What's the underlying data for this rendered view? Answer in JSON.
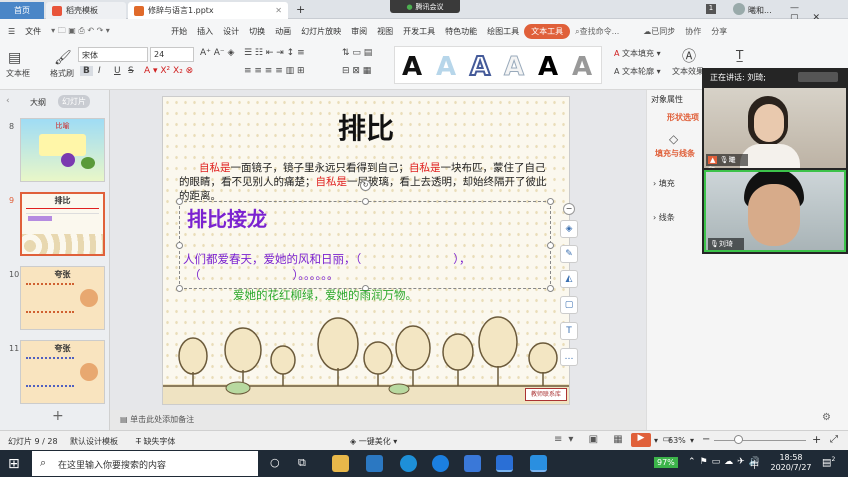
{
  "tabs": {
    "home": "首页",
    "template": "稻壳模板",
    "file": "修辞与语言1.pptx",
    "meeting": "腾讯会议",
    "user": "曦和..."
  },
  "menu": {
    "file": "文件",
    "items": [
      "开始",
      "插入",
      "设计",
      "切换",
      "动画",
      "幻灯片放映",
      "审阅",
      "视图",
      "开发工具",
      "特色功能",
      "绘图工具",
      "文本工具"
    ],
    "search": "查找命令...",
    "sync": "已同步",
    "collab": "协作",
    "share": "分享"
  },
  "toolbar": {
    "textbox": "文本框",
    "painter": "格式刷",
    "font": "宋体",
    "size": "24",
    "fill": "文本填充",
    "outline": "文本轮廓",
    "effect": "文本效果",
    "bold": "B",
    "italic": "I",
    "underline": "U",
    "strike": "S"
  },
  "panel": {
    "outline": "大纲",
    "slides": "幻灯片"
  },
  "thumbs": [
    {
      "num": "8",
      "title": "比喻"
    },
    {
      "num": "9",
      "title": "排比"
    },
    {
      "num": "10",
      "title": "夸张"
    },
    {
      "num": "11",
      "title": "夸张"
    }
  ],
  "slide": {
    "title": "排比",
    "para_prefix1": "自私是",
    "para_a": "一面镜子，镜子里永远只看得到自己；",
    "para_prefix2": "自私是",
    "para_b": "一块布匹，蒙住了自己的眼睛，看不见别人的痛楚；",
    "para_prefix3": "自私是",
    "para_c": "一层玻璃，看上去透明，却始终隔开了彼此的距离。",
    "heading": "排比接龙",
    "line1": "人们都爱春天，爱她的风和日丽，（　　　　　　　　），",
    "line2": "（　　　　　　　　）。。。。。。",
    "line3": "爱她的花红柳绿，爱她的雨润万物。",
    "badge": "教师联系库"
  },
  "rightpanel": {
    "props": "对象属性",
    "shape": "形状选项",
    "fillline": "填充与线条",
    "fill": "填充",
    "line": "线条"
  },
  "video": {
    "speaking": "正在讲话: 刘琦;",
    "p1": "曦和...",
    "p2": "刘琦"
  },
  "status": {
    "slideinfo": "幻灯片 9 / 28",
    "template": "默认设计模板",
    "font": "缺失字体",
    "notes": "单击此处添加备注",
    "beautify": "一键美化",
    "zoom": "63%"
  },
  "taskbar": {
    "search": "在这里输入你要搜索的内容",
    "battery": "97%",
    "ime": "中",
    "time": "18:58",
    "date": "2020/7/27",
    "notif": "2"
  },
  "colors": {
    "accent": "#e0603a",
    "red": "#e02020",
    "purple": "#7b22d0",
    "green": "#2aa82a"
  }
}
